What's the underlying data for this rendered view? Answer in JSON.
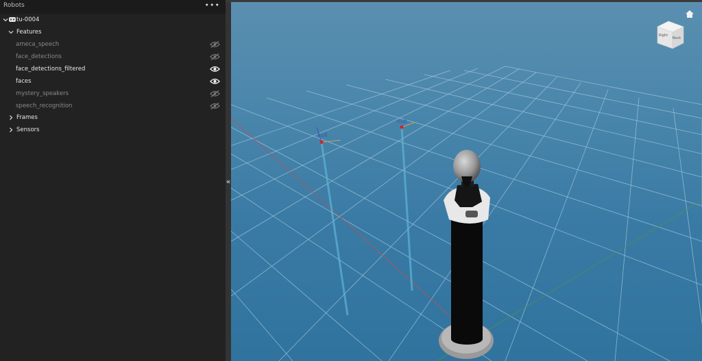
{
  "panel": {
    "title": "Robots",
    "menu_icon": "more-horizontal-icon",
    "collapse_icon": "double-chevron-left-icon"
  },
  "tree": {
    "robot": {
      "name": "tu-0004",
      "icon": "robot-icon"
    },
    "features_label": "Features",
    "features": [
      {
        "label": "ameca_speech",
        "visible": false
      },
      {
        "label": "face_detections",
        "visible": false
      },
      {
        "label": "face_detections_filtered",
        "visible": true
      },
      {
        "label": "faces",
        "visible": true
      },
      {
        "label": "mystery_speakers",
        "visible": false
      },
      {
        "label": "speech_recognition",
        "visible": false
      }
    ],
    "frames_label": "Frames",
    "sensors_label": "Sensors"
  },
  "viewport": {
    "home_icon": "home-icon",
    "view_cube": {
      "face_left": "Right",
      "face_front": "Back"
    },
    "markers": [
      {
        "label": "null"
      },
      {
        "label": "null"
      }
    ],
    "colors": {
      "background": "#3a7ba5",
      "grid": "#9fc3da",
      "x_axis": "#c0504d",
      "y_axis": "#4f8f4f"
    }
  }
}
